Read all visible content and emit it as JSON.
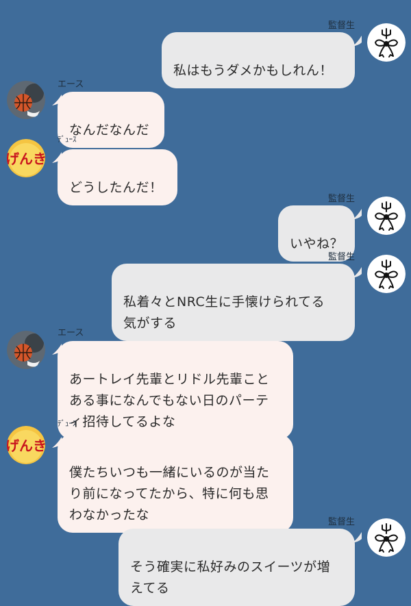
{
  "chat": {
    "messages": [
      {
        "sender": "監督生",
        "avatar": "bow-trident-avatar",
        "text": "私はもうダメかもしれん！"
      },
      {
        "sender": "エース",
        "avatar": "basketball-avatar",
        "text": "なんだなんだ"
      },
      {
        "sender": "ﾃﾞｭｰｽ",
        "avatar": "genki-avatar",
        "text": "どうしたんだ！"
      },
      {
        "sender": "監督生",
        "avatar": "bow-trident-avatar",
        "text": "いやね？"
      },
      {
        "sender": "監督生",
        "avatar": "bow-trident-avatar",
        "text": "私着々とNRC生に手懐けられてる\n気がする"
      },
      {
        "sender": "エース",
        "avatar": "basketball-avatar",
        "text": "あートレイ先輩とリドル先輩こと\nある事になんでもない日のパーテ\nィ招待してるよな"
      },
      {
        "sender": "ﾃﾞｭｰｽ",
        "avatar": "genki-avatar",
        "text": "僕たちいつも一緒にいるのが当た\nり前になってたから、特に何も思\nわなかったな"
      },
      {
        "sender": "監督生",
        "avatar": "bow-trident-avatar",
        "text": "そう確実に私好みのスイーツが増\nえてる"
      }
    ],
    "avatar_labels": {
      "genki": "げんき"
    }
  },
  "colors": {
    "background": "#3f6c9a",
    "outgoing_bubble": "#e9e9ea",
    "incoming_bubble": "#fcf1ee"
  }
}
